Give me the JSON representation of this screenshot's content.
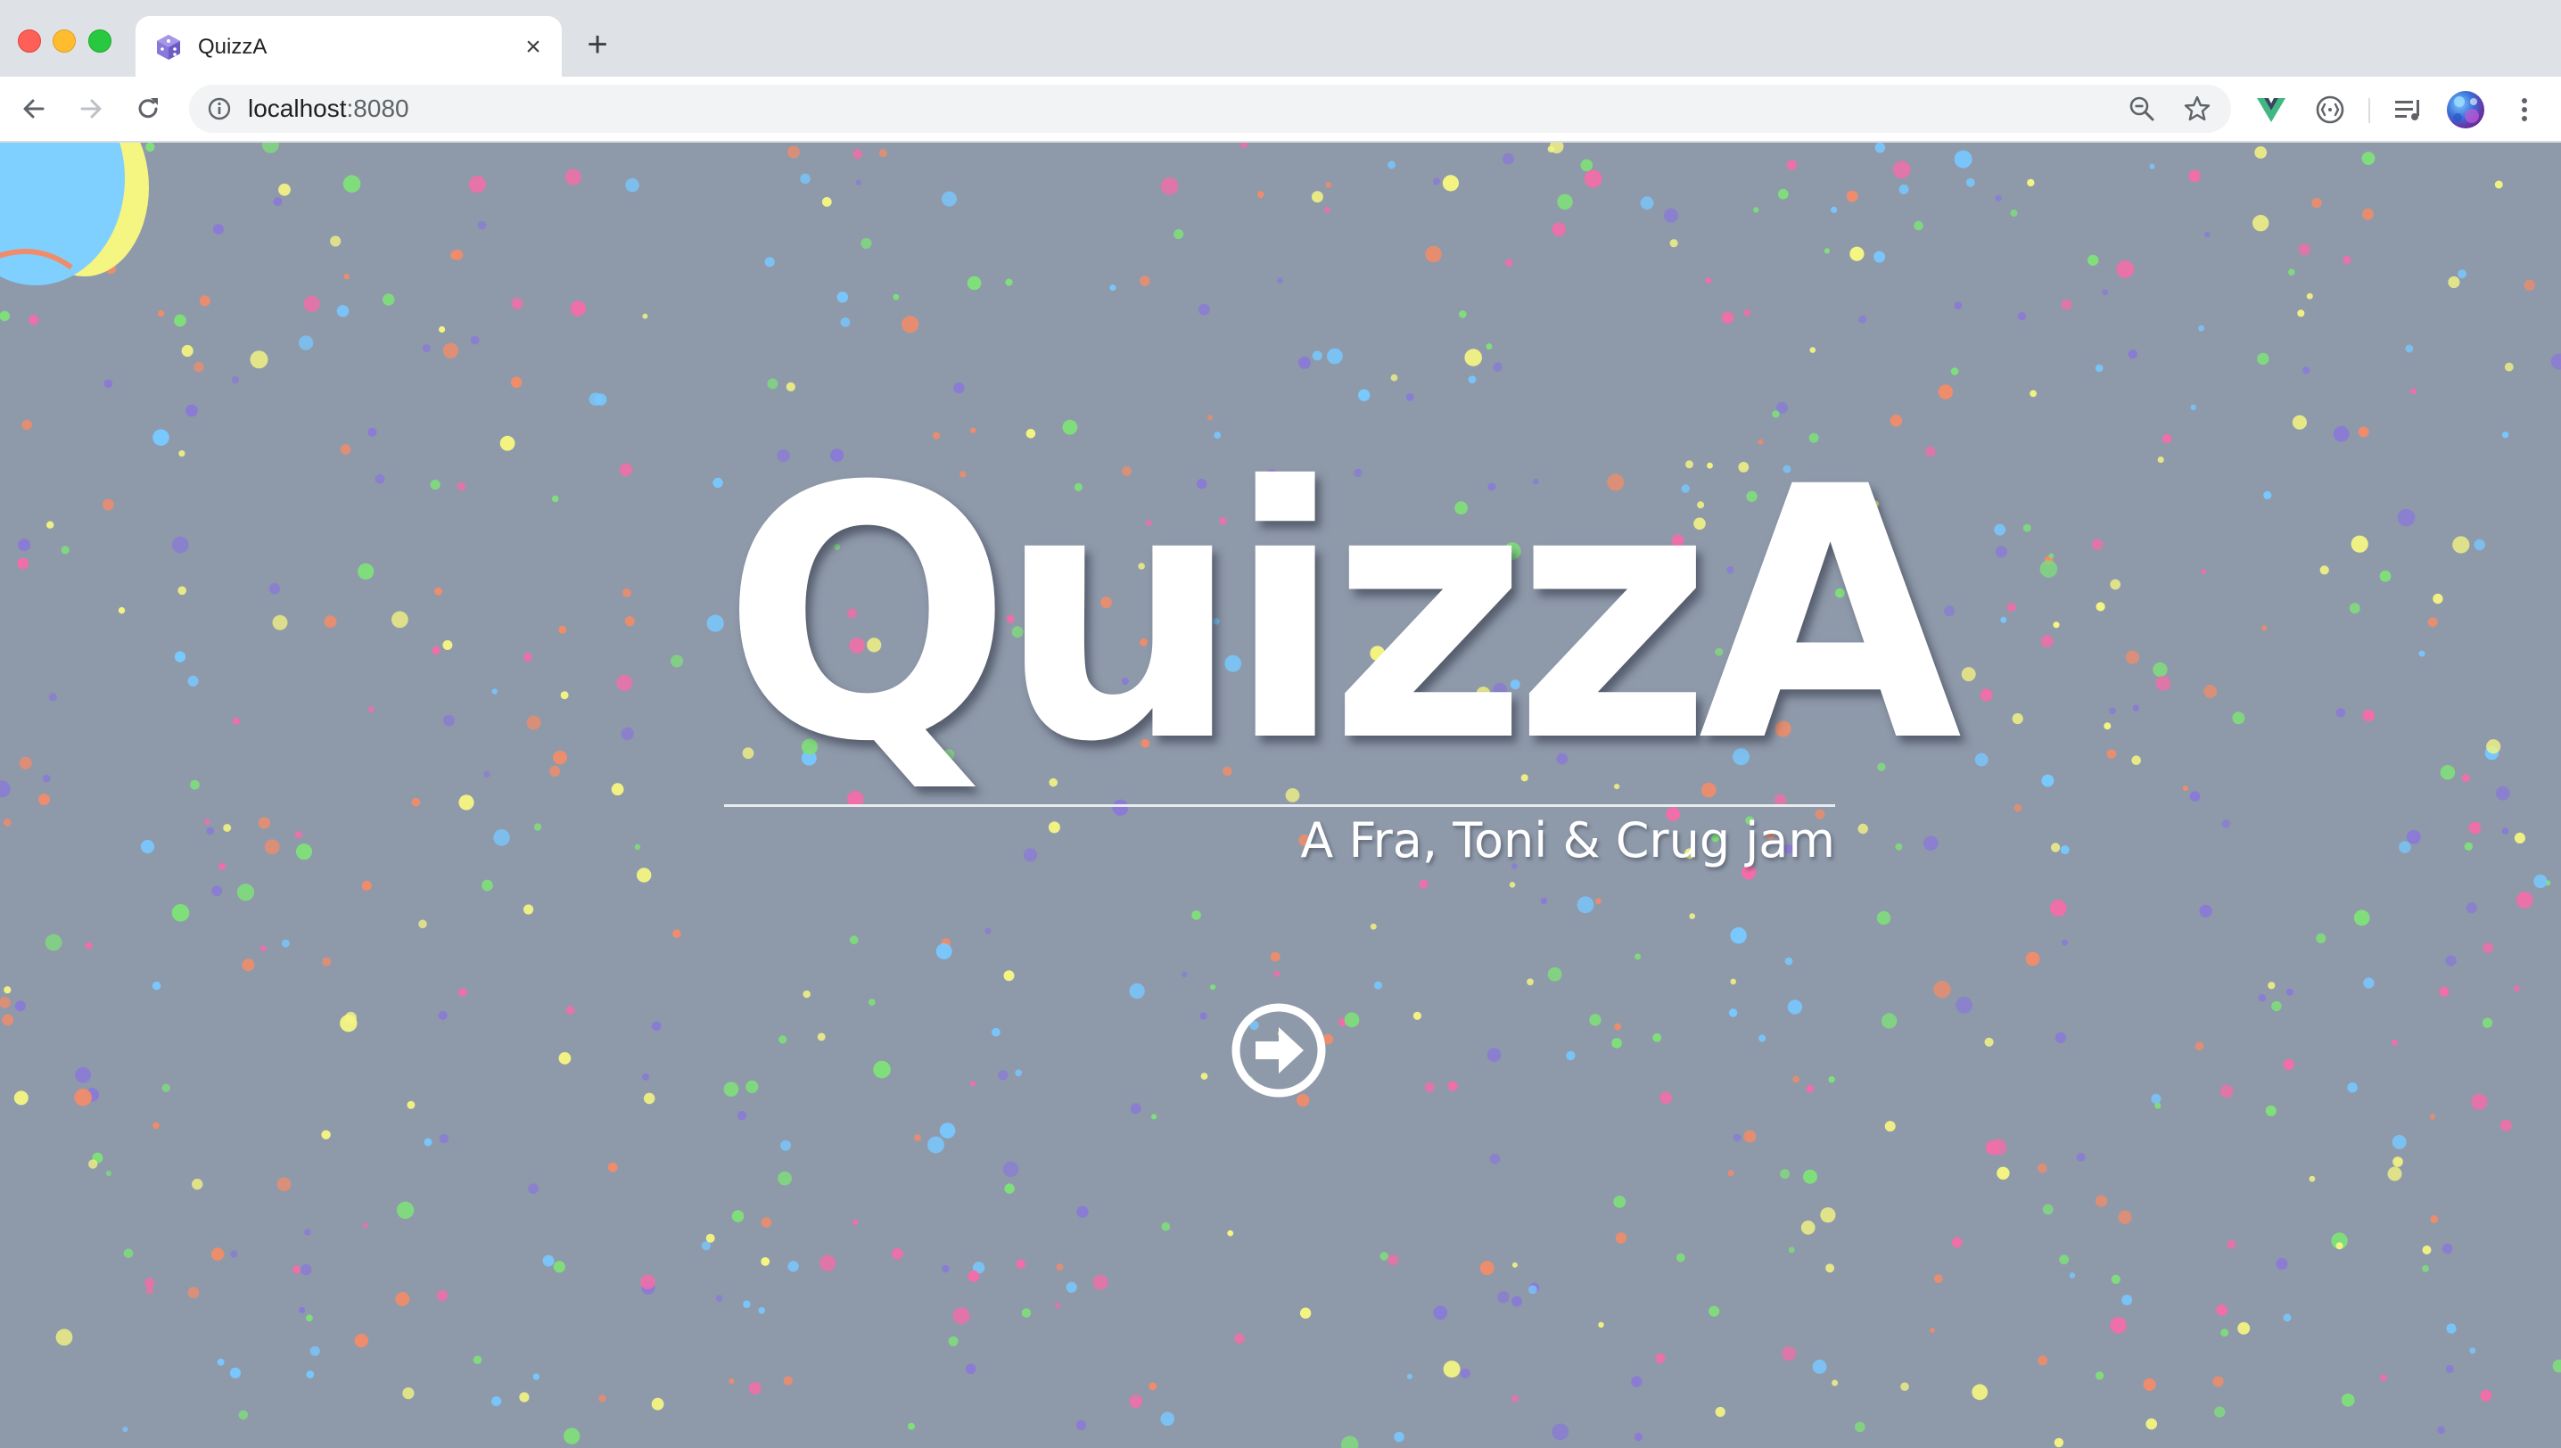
{
  "browser": {
    "tab_title": "QuizzA",
    "tab_favicon": "cube-icon",
    "new_tab_label": "+",
    "close_tab_label": "×",
    "address": {
      "host": "localhost",
      "port": ":8080"
    },
    "toolbar_icons": [
      "back-icon",
      "forward-icon",
      "reload-icon",
      "info-icon",
      "zoom-out-icon",
      "star-icon",
      "vue-devtools-icon",
      "extension-icon",
      "media-control-icon",
      "profile-avatar",
      "menu-icon"
    ]
  },
  "hero": {
    "title": "QuizzA",
    "subtitle": "A Fra, Toni & Crug jam",
    "start_icon": "arrow-right-circle-icon"
  },
  "colors": {
    "page_background": "#8e99aa",
    "confetti": [
      "#f08c6a",
      "#f5f582",
      "#78c8ff",
      "#7fe07a",
      "#f26ea8",
      "#8a7ad6"
    ],
    "title_text": "#ffffff",
    "vue_green": "#41b883"
  }
}
